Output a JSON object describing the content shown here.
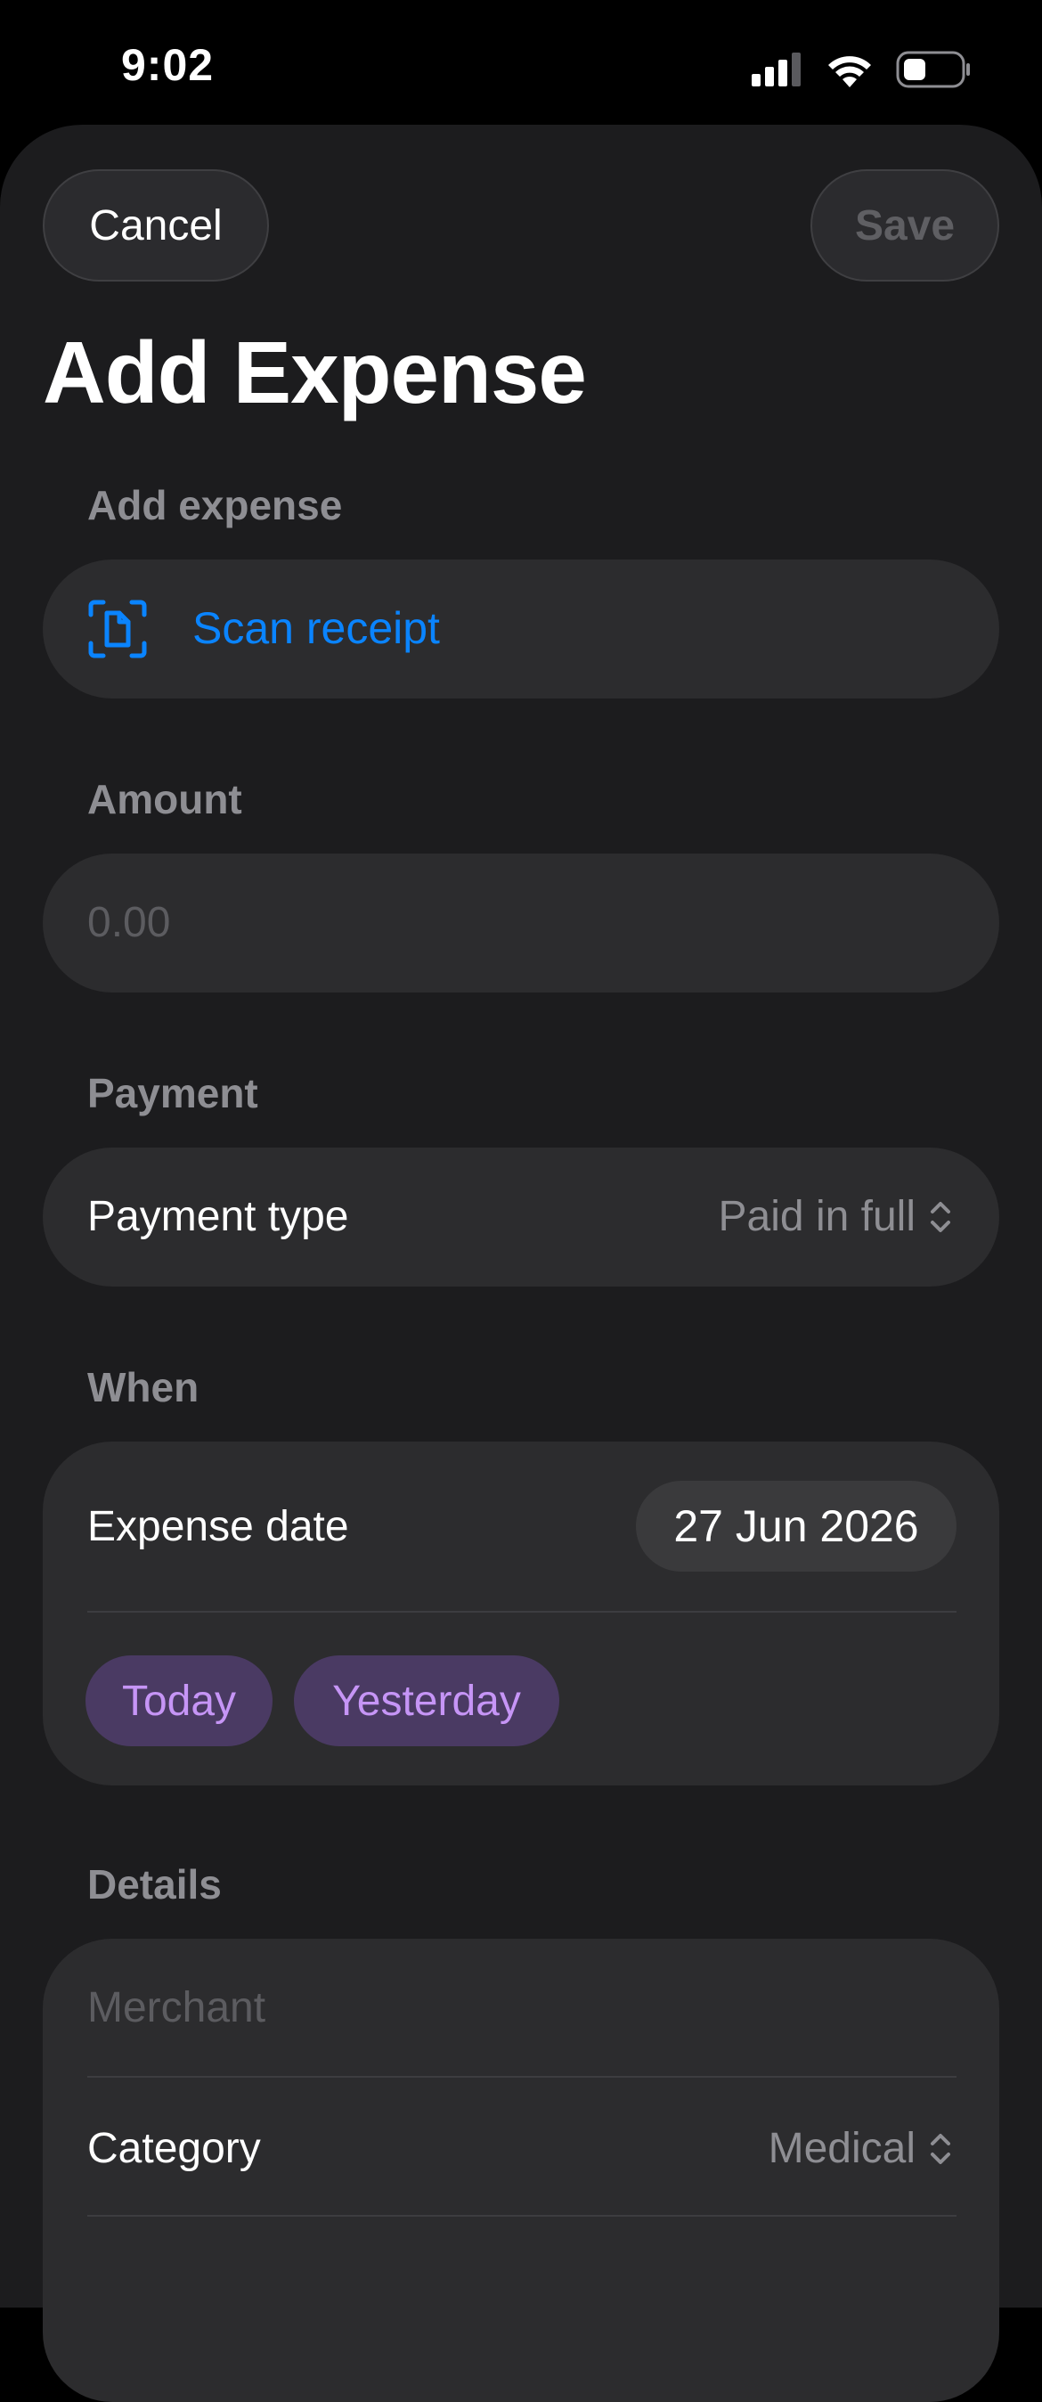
{
  "status_bar": {
    "time": "9:02"
  },
  "header": {
    "cancel_label": "Cancel",
    "save_label": "Save",
    "title": "Add Expense"
  },
  "add_expense": {
    "label": "Add expense",
    "scan_label": "Scan receipt",
    "scan_icon": "document-scan-icon"
  },
  "amount": {
    "label": "Amount",
    "placeholder": "0.00"
  },
  "payment": {
    "label": "Payment",
    "row_label": "Payment type",
    "value": "Paid in full"
  },
  "when": {
    "label": "When",
    "row_label": "Expense date",
    "date": "27 Jun 2026",
    "chips": [
      "Today",
      "Yesterday"
    ]
  },
  "details": {
    "label": "Details",
    "merchant_placeholder": "Merchant",
    "category_label": "Category",
    "category_value": "Medical"
  },
  "colors": {
    "accent": "#0a84ff",
    "chip_text": "#c695f6",
    "chip_bg": "#4a3a63",
    "card_bg": "#2c2c2e",
    "sheet_bg": "#1c1c1e"
  }
}
